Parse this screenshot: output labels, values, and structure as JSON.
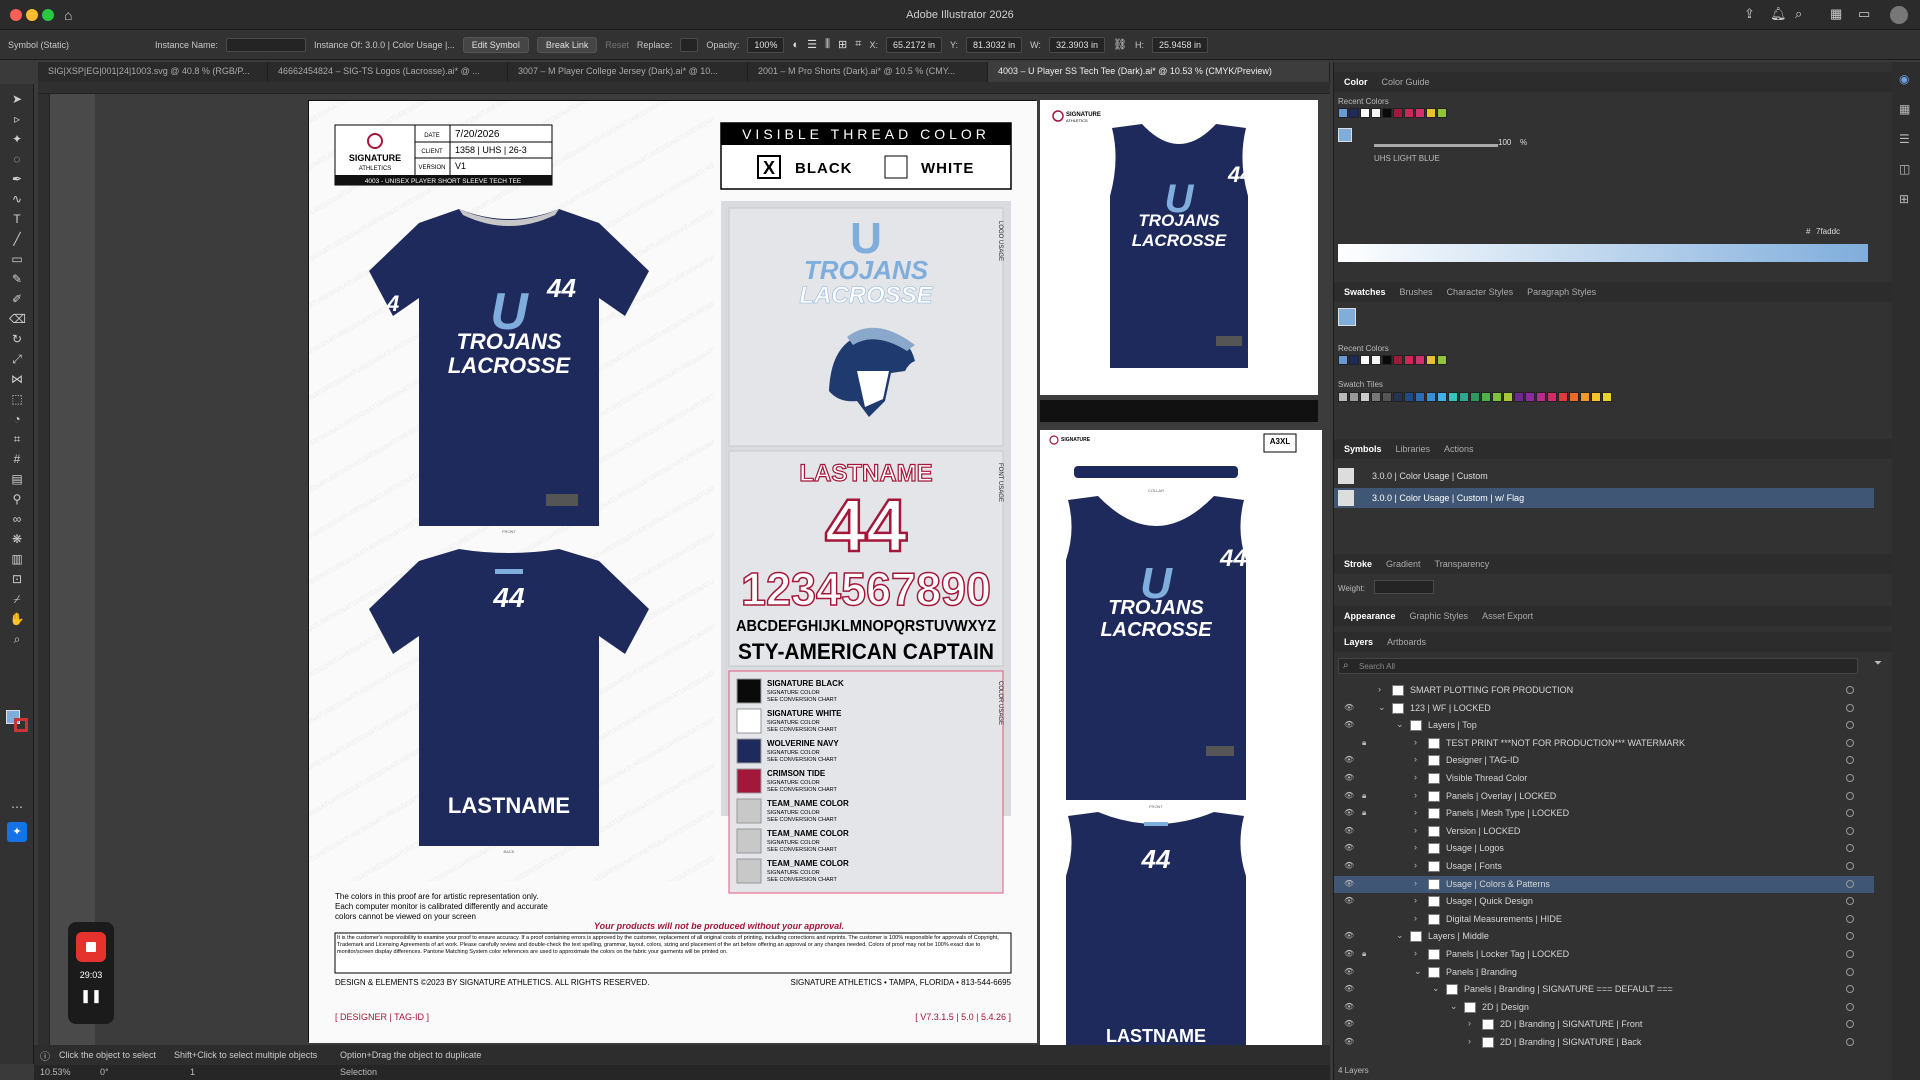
{
  "app": {
    "title": "Adobe Illustrator 2026"
  },
  "control": {
    "symbol_type": "Symbol (Static)",
    "instance_name_label": "Instance Name:",
    "instance_of": "Instance Of: 3.0.0 | Color Usage |...",
    "edit_symbol": "Edit Symbol",
    "break_link": "Break Link",
    "reset": "Reset",
    "replace_label": "Replace:",
    "opacity_label": "Opacity:",
    "opacity_value": "100%",
    "x_label": "X:",
    "x_value": "65.2172 in",
    "y_label": "Y:",
    "y_value": "81.3032 in",
    "w_label": "W:",
    "w_value": "32.3903 in",
    "h_label": "H:",
    "h_value": "25.9458 in"
  },
  "tabs": [
    {
      "label": "SIG|XSP|EG|001|24|1003.svg @ 40.8 % (RGB/P..."
    },
    {
      "label": "46662454824 – SIG-TS Logos (Lacrosse).ai* @ ..."
    },
    {
      "label": "3007 – M Player College Jersey (Dark).ai* @ 10..."
    },
    {
      "label": "2001 – M Pro Shorts (Dark).ai* @ 10.5 % (CMY..."
    },
    {
      "label": "4003 – U Player SS Tech Tee (Dark).ai* @ 10.53 % (CMYK/Preview)"
    }
  ],
  "proof": {
    "brand": "SIGNATURE",
    "brand_sub": "ATHLETICS",
    "date_label": "DATE",
    "date": "7/20/2026",
    "client_label": "CLIENT",
    "client": "1358 | UHS | 26-3",
    "version_label": "VERSION",
    "version": "V1",
    "product": "4003 - UNISEX PLAYER SHORT SLEEVE TECH TEE",
    "thread_title": "VISIBLE THREAD COLOR",
    "thread_black": "BLACK",
    "thread_white": "WHITE",
    "thread_mark": "X",
    "logo_usage": "LOGO USAGE",
    "font_usage": "FONT USAGE",
    "color_usage": "COLOR USAGE",
    "team_letter": "U",
    "team_name": "TROJANS",
    "team_sport": "LACROSSE",
    "jersey_number": "44",
    "lastname": "LASTNAME",
    "digits": "1234567890",
    "alphabet": "ABCDEFGHIJKLMNOPQRSTUVWXYZ",
    "font_name": "STY-AMERICAN CAPTAIN",
    "front_label": "FRONT",
    "back_label": "BACK",
    "colors": [
      {
        "name": "SIGNATURE BLACK",
        "hex": "#0a0a0a",
        "l1": "SIGNATURE COLOR",
        "l2": "SEE CONVERSION CHART"
      },
      {
        "name": "SIGNATURE WHITE",
        "hex": "#ffffff",
        "l1": "SIGNATURE COLOR",
        "l2": "SEE CONVERSION CHART"
      },
      {
        "name": "WOLVERINE NAVY",
        "hex": "#1e2a5c",
        "l1": "SIGNATURE COLOR",
        "l2": "SEE CONVERSION CHART"
      },
      {
        "name": "CRIMSON TIDE",
        "hex": "#a3173a",
        "l1": "SIGNATURE COLOR",
        "l2": "SEE CONVERSION CHART"
      },
      {
        "name": "TEAM_NAME COLOR",
        "hex": "#c8c8c8",
        "l1": "SIGNATURE COLOR",
        "l2": "SEE CONVERSION CHART"
      },
      {
        "name": "TEAM_NAME COLOR",
        "hex": "#c8c8c8",
        "l1": "SIGNATURE COLOR",
        "l2": "SEE CONVERSION CHART"
      },
      {
        "name": "TEAM_NAME COLOR",
        "hex": "#c8c8c8",
        "l1": "SIGNATURE COLOR",
        "l2": "SEE CONVERSION CHART"
      }
    ],
    "disclaimer_1": "The colors in this proof are for artistic representation only.",
    "disclaimer_2": "Each computer monitor is calibrated differently and accurate",
    "disclaimer_3": "colors cannot be viewed on your screen",
    "approval": "Your products will not be produced without your approval.",
    "legal": "It is the customer's responsibility to examine your proof to ensure accuracy. If a proof containing errors is approved by the customer, replacement of all original costs of printing, including corrections and reprints. The customer is 100% responsible for approvals of Copyright, Trademark and Licensing Agreements of art work. Please carefully review and double-check the text spelling, grammar, layout, colors, sizing and placement of the art before offering an approval or any changes needed. Colors of proof may not be 100% exact due to monitor/screen display differences. Pantone Matching System color references are used to approximate the colors on the fabric your garments will be printed on.",
    "copyright": "DESIGN & ELEMENTS ©2023 BY SIGNATURE ATHLETICS. ALL RIGHTS RESERVED.",
    "address": "SIGNATURE ATHLETICS • TAMPA, FLORIDA • 813-544-6695",
    "designer": "[ DESIGNER | TAG-ID ]",
    "footer_version": "[ V7.3.1.5 | 5.0 | 5.4.26 ]",
    "size_tag": "A3XL",
    "collar_label": "COLLAR"
  },
  "recorder": {
    "time": "29:03"
  },
  "status": {
    "hint": "Click the object to select",
    "hint2": "Shift+Click to select multiple objects",
    "hint3": "Option+Drag the object to duplicate",
    "zoom": "10.53%",
    "rotation": "0°",
    "artboard": "1",
    "mode": "Selection"
  },
  "panels": {
    "color_tab": "Color",
    "color_guide_tab": "Color Guide",
    "recent_colors": "Recent Colors",
    "tint_value": "100",
    "tint_unit": "%",
    "swatch_name": "UHS LIGHT BLUE",
    "hex_label": "#",
    "hex_value": "7faddc",
    "swatches_tab": "Swatches",
    "brushes_tab": "Brushes",
    "char_styles_tab": "Character Styles",
    "para_styles_tab": "Paragraph Styles",
    "recent_colors2": "Recent Colors",
    "swatch_tiles": "Swatch Tiles",
    "symbols_tab": "Symbols",
    "libraries_tab": "Libraries",
    "actions_tab": "Actions",
    "symbol_1": "3.0.0 | Color Usage | Custom",
    "symbol_2": "3.0.0 | Color Usage | Custom | w/ Flag",
    "stroke_tab": "Stroke",
    "gradient_tab": "Gradient",
    "transparency_tab": "Transparency",
    "weight_label": "Weight:",
    "appearance_tab": "Appearance",
    "graphic_styles_tab": "Graphic Styles",
    "asset_export_tab": "Asset Export",
    "layers_tab": "Layers",
    "artboards_tab": "Artboards",
    "search_placeholder": "Search All",
    "layer_count": "4 Layers",
    "recent": [
      "#6a9ad4",
      "#1e2a5c",
      "#ffffff",
      "#f4f4f4",
      "#0a0a0a",
      "#a3173a",
      "#c82a55",
      "#d12f6e",
      "#e8c22c",
      "#8fc43c"
    ],
    "tiles": [
      "#bbbbbb",
      "#999999",
      "#cccccc",
      "#777777",
      "#555555",
      "#223355",
      "#1e4a8a",
      "#2a6cb4",
      "#3590d8",
      "#3cb4e6",
      "#35c4c0",
      "#30a890",
      "#2a9a5c",
      "#4cb444",
      "#7ac43c",
      "#a8c838",
      "#6a2c8c",
      "#8a2c9c",
      "#b42c8c",
      "#d02c6a",
      "#e03a3a",
      "#e86a2c",
      "#f09a2c",
      "#f4c42c",
      "#e8d42c"
    ]
  },
  "layers": [
    {
      "name": "SMART PLOTTING FOR PRODUCTION",
      "indent": 0,
      "eye": false,
      "lock": false,
      "exp": "›"
    },
    {
      "name": "123 | WF | LOCKED",
      "indent": 0,
      "eye": true,
      "lock": false,
      "exp": "⌄"
    },
    {
      "name": "Layers | Top",
      "indent": 1,
      "eye": true,
      "lock": false,
      "exp": "⌄"
    },
    {
      "name": "TEST PRINT ***NOT FOR PRODUCTION*** WATERMARK",
      "indent": 2,
      "eye": false,
      "lock": true,
      "exp": "›"
    },
    {
      "name": "Designer | TAG-ID",
      "indent": 2,
      "eye": true,
      "lock": false,
      "exp": "›"
    },
    {
      "name": "Visible Thread Color",
      "indent": 2,
      "eye": true,
      "lock": false,
      "exp": "›"
    },
    {
      "name": "Panels | Overlay | LOCKED",
      "indent": 2,
      "eye": true,
      "lock": true,
      "exp": "›"
    },
    {
      "name": "Panels | Mesh Type | LOCKED",
      "indent": 2,
      "eye": true,
      "lock": true,
      "exp": "›"
    },
    {
      "name": "Version | LOCKED",
      "indent": 2,
      "eye": true,
      "lock": false,
      "exp": "›"
    },
    {
      "name": "Usage | Logos",
      "indent": 2,
      "eye": true,
      "lock": false,
      "exp": "›"
    },
    {
      "name": "Usage | Fonts",
      "indent": 2,
      "eye": true,
      "lock": false,
      "exp": "›"
    },
    {
      "name": "Usage | Colors & Patterns",
      "indent": 2,
      "eye": true,
      "lock": false,
      "exp": "›",
      "sel": true
    },
    {
      "name": "Usage | Quick Design",
      "indent": 2,
      "eye": true,
      "lock": false,
      "exp": "›"
    },
    {
      "name": "Digital Measurements | HIDE",
      "indent": 2,
      "eye": false,
      "lock": false,
      "exp": "›"
    },
    {
      "name": "Layers | Middle",
      "indent": 1,
      "eye": true,
      "lock": false,
      "exp": "⌄"
    },
    {
      "name": "Panels | Locker Tag | LOCKED",
      "indent": 2,
      "eye": true,
      "lock": true,
      "exp": "›"
    },
    {
      "name": "Panels | Branding",
      "indent": 2,
      "eye": true,
      "lock": false,
      "exp": "⌄"
    },
    {
      "name": "Panels | Branding | SIGNATURE  ===  DEFAULT  ===",
      "indent": 3,
      "eye": true,
      "lock": false,
      "exp": "⌄"
    },
    {
      "name": "2D | Design",
      "indent": 4,
      "eye": true,
      "lock": false,
      "exp": "⌄"
    },
    {
      "name": "2D | Branding | SIGNATURE | Front",
      "indent": 5,
      "eye": true,
      "lock": false,
      "exp": "›"
    },
    {
      "name": "2D | Branding | SIGNATURE | Back",
      "indent": 5,
      "eye": true,
      "lock": false,
      "exp": "›"
    }
  ]
}
